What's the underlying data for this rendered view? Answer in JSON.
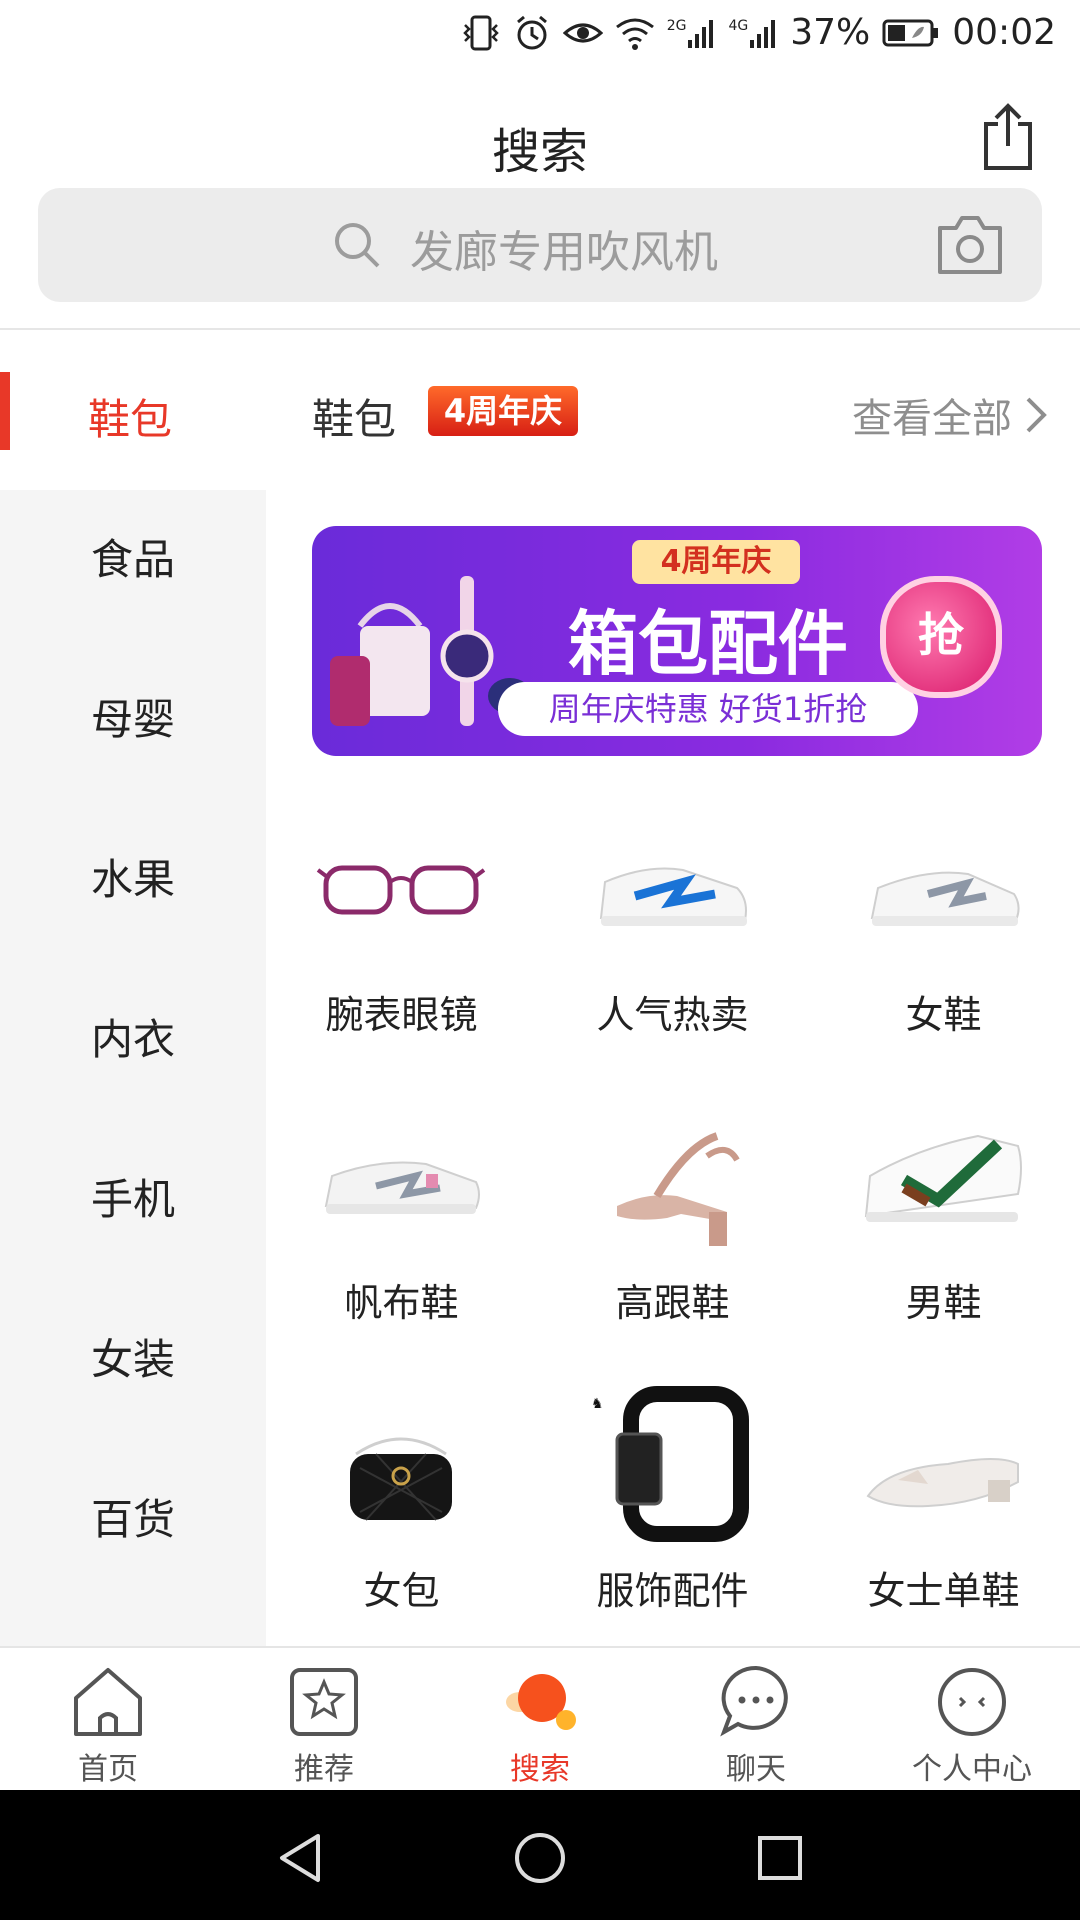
{
  "status_bar": {
    "battery": "37%",
    "time": "00:02",
    "signal_2g": "2G",
    "signal_4g": "4G"
  },
  "header": {
    "title": "搜索"
  },
  "search": {
    "placeholder": "发廊专用吹风机"
  },
  "section": {
    "active_category": "鞋包",
    "title": "鞋包",
    "badge": "4周年庆",
    "view_all": "查看全部"
  },
  "sidebar": {
    "items": [
      {
        "label": "食品"
      },
      {
        "label": "母婴"
      },
      {
        "label": "水果"
      },
      {
        "label": "内衣"
      },
      {
        "label": "手机"
      },
      {
        "label": "女装"
      },
      {
        "label": "百货"
      }
    ]
  },
  "banner": {
    "badge": "4周年庆",
    "title": "箱包配件",
    "subtitle": "周年庆特惠  好货1折抢",
    "grab": "抢"
  },
  "grid": {
    "items": [
      {
        "label": "腕表眼镜",
        "icon": "glasses"
      },
      {
        "label": "人气热卖",
        "icon": "sneaker-blue"
      },
      {
        "label": "女鞋",
        "icon": "sneaker-grey"
      },
      {
        "label": "帆布鞋",
        "icon": "canvas-shoe"
      },
      {
        "label": "高跟鞋",
        "icon": "heel-sandal"
      },
      {
        "label": "男鞋",
        "icon": "sneaker-green"
      },
      {
        "label": "女包",
        "icon": "handbag"
      },
      {
        "label": "服饰配件",
        "icon": "belt"
      },
      {
        "label": "女士单鞋",
        "icon": "flat-shoe"
      }
    ]
  },
  "bottom_nav": {
    "items": [
      {
        "label": "首页",
        "icon": "home-icon"
      },
      {
        "label": "推荐",
        "icon": "star-icon"
      },
      {
        "label": "搜索",
        "icon": "search-ball-icon",
        "active": true
      },
      {
        "label": "聊天",
        "icon": "chat-icon"
      },
      {
        "label": "个人中心",
        "icon": "profile-icon"
      }
    ]
  },
  "colors": {
    "accent": "#e83828",
    "sidebar_bg": "#f5f5f5",
    "search_bg": "#ececec"
  }
}
